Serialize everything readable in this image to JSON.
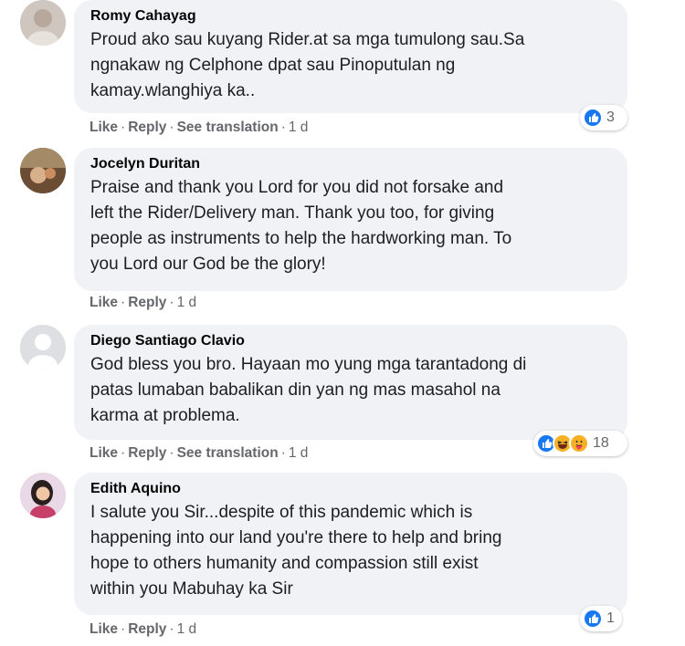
{
  "comments": [
    {
      "author": "Romy Cahayag",
      "text": "Proud ako sau kuyang Rider.at sa mga tumulong sau.Sa\nngnakaw ng Celphone dpat sau Pinoputulan ng\nkamay.wlanghiya ka..",
      "actions": {
        "like": "Like",
        "reply": "Reply",
        "translate": "See translation",
        "time": "1 d"
      },
      "reactions": {
        "icons": [
          "like-icon"
        ],
        "count": "3"
      }
    },
    {
      "author": "Jocelyn Duritan",
      "text": "Praise and thank you Lord for you did not forsake and\nleft the Rider/Delivery man. Thank you too, for giving\npeople as instruments to help the hardworking man. To\nyou Lord our God be the glory!",
      "actions": {
        "like": "Like",
        "reply": "Reply",
        "time": "1 d"
      }
    },
    {
      "author": "Diego Santiago Clavio",
      "text": "God bless you bro. Hayaan mo yung mga tarantadong di\npatas lumaban babalikan din yan ng mas masahol na\nkarma at problema.",
      "actions": {
        "like": "Like",
        "reply": "Reply",
        "translate": "See translation",
        "time": "1 d"
      },
      "reactions": {
        "icons": [
          "like-icon",
          "haha-icon",
          "care-icon"
        ],
        "count": "18"
      }
    },
    {
      "author": "Edith Aquino",
      "text": "I salute you Sir...despite of this pandemic which is\nhappening into our land you're there to help and bring\nhope to others humanity and compassion still exist\nwithin you Mabuhay ka Sir",
      "actions": {
        "like": "Like",
        "reply": "Reply",
        "time": "1 d"
      },
      "reactions": {
        "icons": [
          "like-icon"
        ],
        "count": "1"
      }
    }
  ],
  "colors": {
    "bubble": "#f0f2f5",
    "like_blue": "#1877f2",
    "muted": "#65676b"
  }
}
